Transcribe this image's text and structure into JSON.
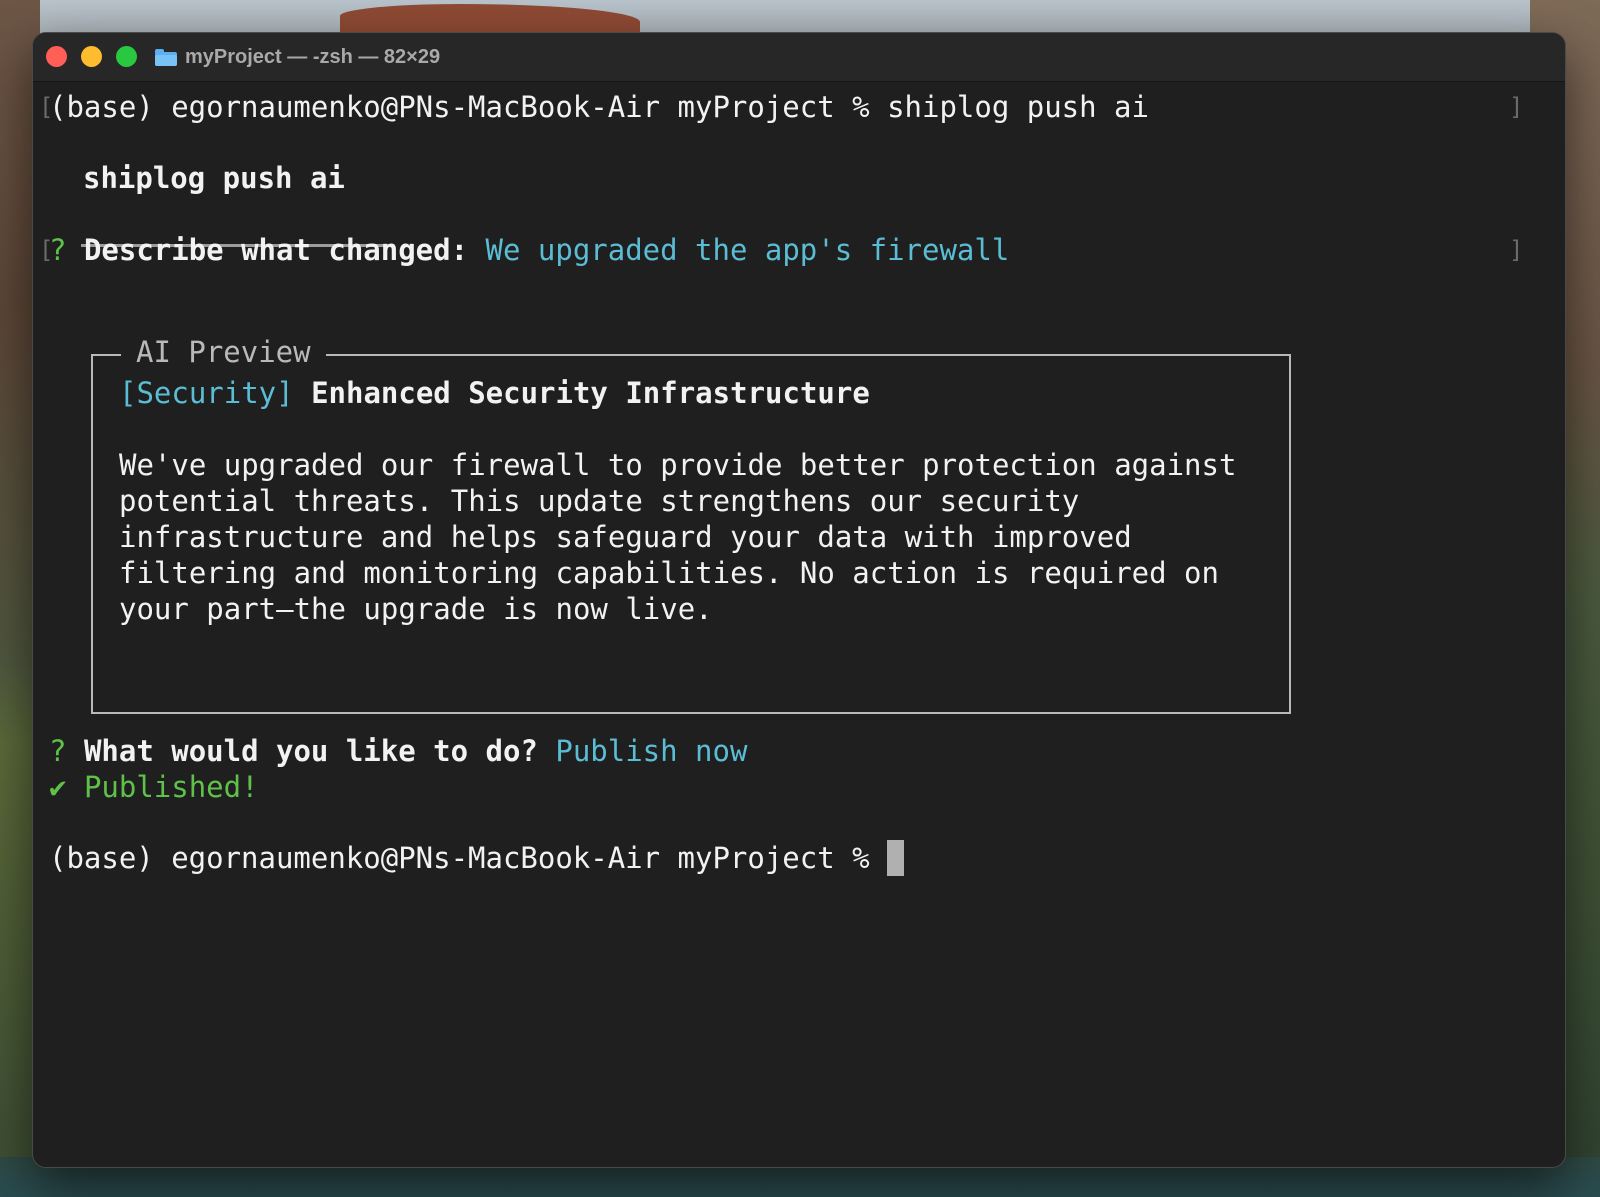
{
  "window": {
    "title": "myProject — -zsh — 82×29",
    "folder_icon": "folder-icon"
  },
  "terminal": {
    "prompt1": "(base) egornaumenko@PNs-MacBook-Air myProject % ",
    "command1": "shiplog push ai",
    "header": "shiplog push ai",
    "q1_mark": "?",
    "q1_label": "Describe what changed:",
    "q1_answer": "We upgraded the app's firewall",
    "preview": {
      "title": "AI Preview",
      "tag": "[Security]",
      "heading": "Enhanced Security Infrastructure",
      "body_lines": [
        "We've upgraded our firewall to provide better protection against",
        "potential threats. This update strengthens our security",
        "infrastructure and helps safeguard your data with improved",
        "filtering and monitoring capabilities. No action is required on",
        "your part—the upgrade is now live."
      ]
    },
    "q2_mark": "?",
    "q2_label": "What would you like to do?",
    "q2_answer": "Publish now",
    "success_mark": "✔",
    "success_text": "Published!",
    "prompt2": "(base) egornaumenko@PNs-MacBook-Air myProject % "
  },
  "colors": {
    "accent_cyan": "#5bbdd4",
    "success_green": "#5fc14a",
    "background": "#1f1f1f"
  }
}
